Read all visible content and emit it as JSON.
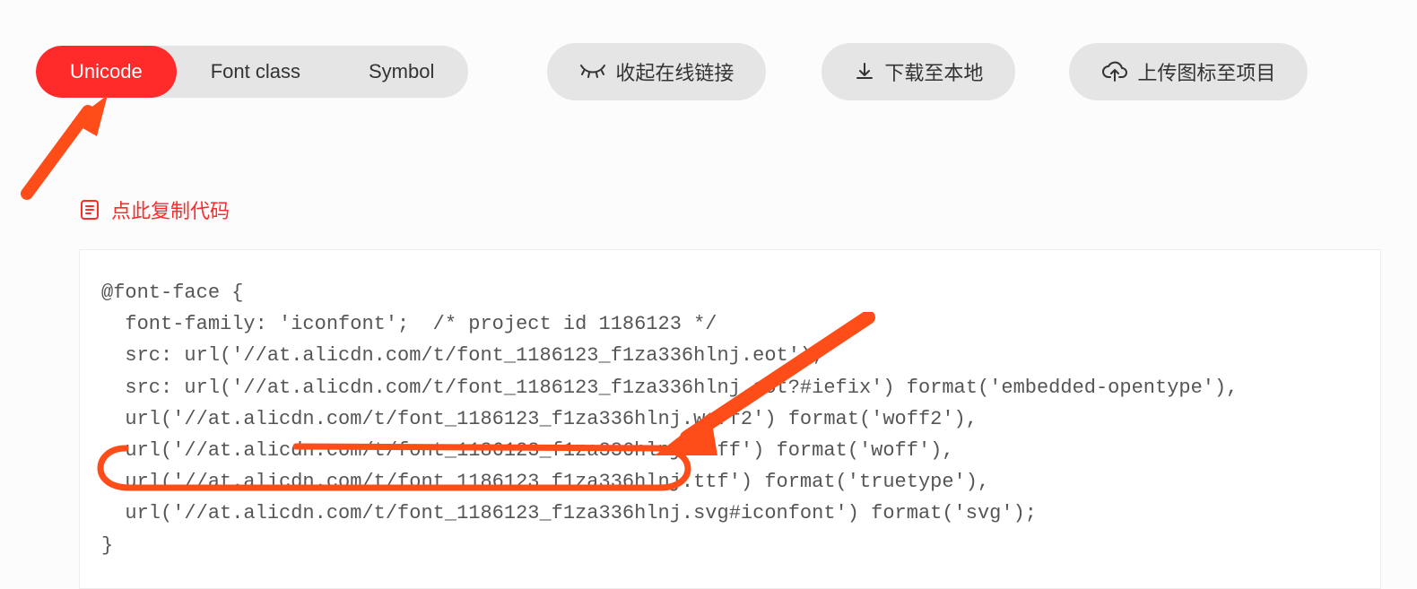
{
  "tabs": {
    "unicode": "Unicode",
    "fontclass": "Font class",
    "symbol": "Symbol"
  },
  "actions": {
    "collapseLink": "收起在线链接",
    "downloadLocal": "下载至本地",
    "uploadProject": "上传图标至项目"
  },
  "copyCode": "点此复制代码",
  "code": "@font-face {\n  font-family: 'iconfont';  /* project id 1186123 */\n  src: url('//at.alicdn.com/t/font_1186123_f1za336hlnj.eot');\n  src: url('//at.alicdn.com/t/font_1186123_f1za336hlnj.eot?#iefix') format('embedded-opentype'),\n  url('//at.alicdn.com/t/font_1186123_f1za336hlnj.woff2') format('woff2'),\n  url('//at.alicdn.com/t/font_1186123_f1za336hlnj.woff') format('woff'),\n  url('//at.alicdn.com/t/font_1186123_f1za336hlnj.ttf') format('truetype'),\n  url('//at.alicdn.com/t/font_1186123_f1za336hlnj.svg#iconfont') format('svg');\n}"
}
